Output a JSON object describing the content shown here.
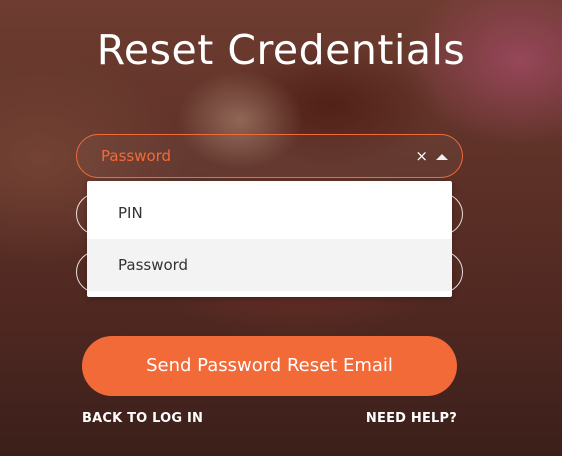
{
  "page": {
    "title": "Reset Credentials"
  },
  "select": {
    "selected_value": "Password",
    "clear_glyph": "×",
    "options": [
      {
        "label": "PIN",
        "selected": false
      },
      {
        "label": "Password",
        "selected": true
      }
    ]
  },
  "actions": {
    "send_label": "Send Password Reset Email",
    "back_label": "BACK TO LOG IN",
    "help_label": "NEED HELP?"
  },
  "colors": {
    "accent": "#f26a38",
    "text_on_accent": "#ffffff",
    "dropdown_bg": "#ffffff",
    "selected_option_bg": "#f3f3f3"
  },
  "icons": {
    "clear": "close-icon",
    "toggle": "chevron-up-icon"
  }
}
